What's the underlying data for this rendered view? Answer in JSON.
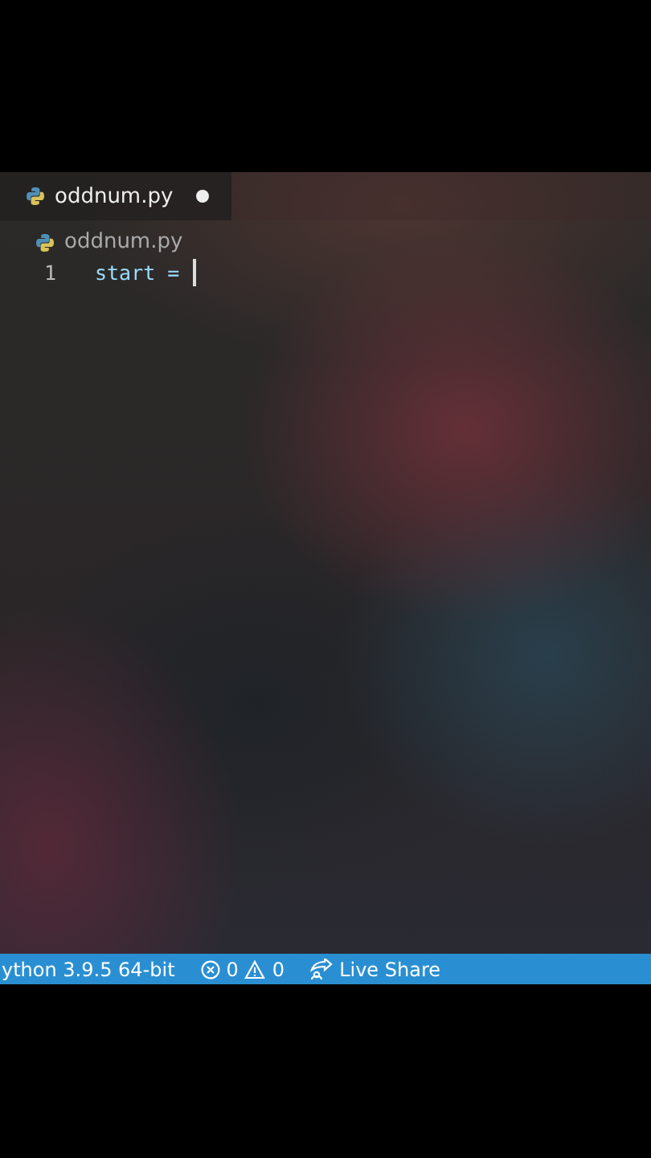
{
  "tabs": [
    {
      "label": "oddnum.py",
      "selected": true,
      "modified": true
    }
  ],
  "breadcrumb": {
    "label": "oddnum.py"
  },
  "lines": [
    {
      "number": "1",
      "code": "start ="
    }
  ],
  "status_bar": {
    "interpreter": "ython 3.9.5 64-bit",
    "errors": "0",
    "warnings": "0",
    "live_share": "Live Share"
  }
}
